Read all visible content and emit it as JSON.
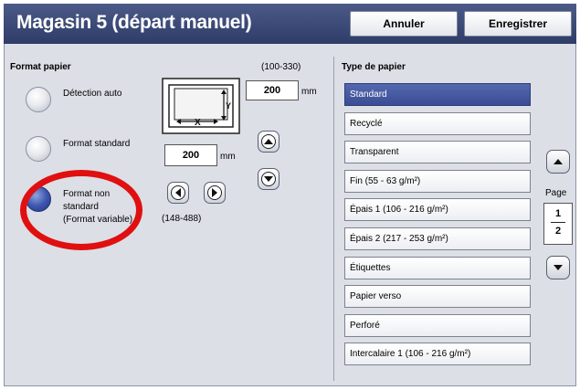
{
  "header": {
    "title": "Magasin 5 (départ manuel)",
    "cancel_label": "Annuler",
    "save_label": "Enregistrer"
  },
  "paper_format": {
    "section_title": "Format papier",
    "options": [
      {
        "label": "Détection auto",
        "selected": false
      },
      {
        "label": "Format standard",
        "selected": false
      },
      {
        "label": "Format non\nstandard\n(Format variable)",
        "selected": true
      }
    ],
    "y_range": "(100-330)",
    "y_value": "200",
    "y_unit": "mm",
    "x_value": "200",
    "x_unit": "mm",
    "x_range": "(148-488)",
    "diagram_x_label": "X",
    "diagram_y_label": "Y"
  },
  "paper_type": {
    "section_title": "Type de papier",
    "items": [
      {
        "label": "Standard",
        "selected": true
      },
      {
        "label": "Recyclé",
        "selected": false
      },
      {
        "label": "Transparent",
        "selected": false
      },
      {
        "label": "Fin (55 - 63 g/m²)",
        "selected": false
      },
      {
        "label": "Épais 1 (106 - 216 g/m²)",
        "selected": false
      },
      {
        "label": "Épais 2 (217 - 253 g/m²)",
        "selected": false
      },
      {
        "label": "Étiquettes",
        "selected": false
      },
      {
        "label": "Papier verso",
        "selected": false
      },
      {
        "label": "Perforé",
        "selected": false
      },
      {
        "label": "Intercalaire 1 (106 - 216 g/m²)",
        "selected": false
      }
    ]
  },
  "pager": {
    "label": "Page",
    "current": "1",
    "total": "2"
  },
  "colors": {
    "title_bar": "#3a4877",
    "selected_item": "#4457a0",
    "highlight_ring": "#e01010"
  }
}
